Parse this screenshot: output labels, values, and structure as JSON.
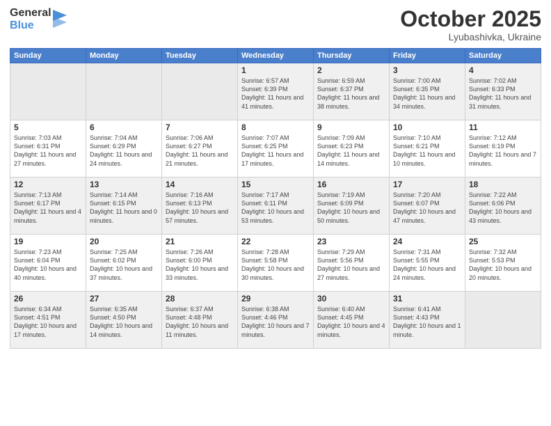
{
  "logo": {
    "general": "General",
    "blue": "Blue"
  },
  "header": {
    "month": "October 2025",
    "location": "Lyubashivka, Ukraine"
  },
  "weekdays": [
    "Sunday",
    "Monday",
    "Tuesday",
    "Wednesday",
    "Thursday",
    "Friday",
    "Saturday"
  ],
  "weeks": [
    [
      {
        "day": "",
        "sunrise": "",
        "sunset": "",
        "daylight": "",
        "empty": true
      },
      {
        "day": "",
        "sunrise": "",
        "sunset": "",
        "daylight": "",
        "empty": true
      },
      {
        "day": "",
        "sunrise": "",
        "sunset": "",
        "daylight": "",
        "empty": true
      },
      {
        "day": "1",
        "sunrise": "Sunrise: 6:57 AM",
        "sunset": "Sunset: 6:39 PM",
        "daylight": "Daylight: 11 hours and 41 minutes."
      },
      {
        "day": "2",
        "sunrise": "Sunrise: 6:59 AM",
        "sunset": "Sunset: 6:37 PM",
        "daylight": "Daylight: 11 hours and 38 minutes."
      },
      {
        "day": "3",
        "sunrise": "Sunrise: 7:00 AM",
        "sunset": "Sunset: 6:35 PM",
        "daylight": "Daylight: 11 hours and 34 minutes."
      },
      {
        "day": "4",
        "sunrise": "Sunrise: 7:02 AM",
        "sunset": "Sunset: 6:33 PM",
        "daylight": "Daylight: 11 hours and 31 minutes."
      }
    ],
    [
      {
        "day": "5",
        "sunrise": "Sunrise: 7:03 AM",
        "sunset": "Sunset: 6:31 PM",
        "daylight": "Daylight: 11 hours and 27 minutes."
      },
      {
        "day": "6",
        "sunrise": "Sunrise: 7:04 AM",
        "sunset": "Sunset: 6:29 PM",
        "daylight": "Daylight: 11 hours and 24 minutes."
      },
      {
        "day": "7",
        "sunrise": "Sunrise: 7:06 AM",
        "sunset": "Sunset: 6:27 PM",
        "daylight": "Daylight: 11 hours and 21 minutes."
      },
      {
        "day": "8",
        "sunrise": "Sunrise: 7:07 AM",
        "sunset": "Sunset: 6:25 PM",
        "daylight": "Daylight: 11 hours and 17 minutes."
      },
      {
        "day": "9",
        "sunrise": "Sunrise: 7:09 AM",
        "sunset": "Sunset: 6:23 PM",
        "daylight": "Daylight: 11 hours and 14 minutes."
      },
      {
        "day": "10",
        "sunrise": "Sunrise: 7:10 AM",
        "sunset": "Sunset: 6:21 PM",
        "daylight": "Daylight: 11 hours and 10 minutes."
      },
      {
        "day": "11",
        "sunrise": "Sunrise: 7:12 AM",
        "sunset": "Sunset: 6:19 PM",
        "daylight": "Daylight: 11 hours and 7 minutes."
      }
    ],
    [
      {
        "day": "12",
        "sunrise": "Sunrise: 7:13 AM",
        "sunset": "Sunset: 6:17 PM",
        "daylight": "Daylight: 11 hours and 4 minutes."
      },
      {
        "day": "13",
        "sunrise": "Sunrise: 7:14 AM",
        "sunset": "Sunset: 6:15 PM",
        "daylight": "Daylight: 11 hours and 0 minutes."
      },
      {
        "day": "14",
        "sunrise": "Sunrise: 7:16 AM",
        "sunset": "Sunset: 6:13 PM",
        "daylight": "Daylight: 10 hours and 57 minutes."
      },
      {
        "day": "15",
        "sunrise": "Sunrise: 7:17 AM",
        "sunset": "Sunset: 6:11 PM",
        "daylight": "Daylight: 10 hours and 53 minutes."
      },
      {
        "day": "16",
        "sunrise": "Sunrise: 7:19 AM",
        "sunset": "Sunset: 6:09 PM",
        "daylight": "Daylight: 10 hours and 50 minutes."
      },
      {
        "day": "17",
        "sunrise": "Sunrise: 7:20 AM",
        "sunset": "Sunset: 6:07 PM",
        "daylight": "Daylight: 10 hours and 47 minutes."
      },
      {
        "day": "18",
        "sunrise": "Sunrise: 7:22 AM",
        "sunset": "Sunset: 6:06 PM",
        "daylight": "Daylight: 10 hours and 43 minutes."
      }
    ],
    [
      {
        "day": "19",
        "sunrise": "Sunrise: 7:23 AM",
        "sunset": "Sunset: 6:04 PM",
        "daylight": "Daylight: 10 hours and 40 minutes."
      },
      {
        "day": "20",
        "sunrise": "Sunrise: 7:25 AM",
        "sunset": "Sunset: 6:02 PM",
        "daylight": "Daylight: 10 hours and 37 minutes."
      },
      {
        "day": "21",
        "sunrise": "Sunrise: 7:26 AM",
        "sunset": "Sunset: 6:00 PM",
        "daylight": "Daylight: 10 hours and 33 minutes."
      },
      {
        "day": "22",
        "sunrise": "Sunrise: 7:28 AM",
        "sunset": "Sunset: 5:58 PM",
        "daylight": "Daylight: 10 hours and 30 minutes."
      },
      {
        "day": "23",
        "sunrise": "Sunrise: 7:29 AM",
        "sunset": "Sunset: 5:56 PM",
        "daylight": "Daylight: 10 hours and 27 minutes."
      },
      {
        "day": "24",
        "sunrise": "Sunrise: 7:31 AM",
        "sunset": "Sunset: 5:55 PM",
        "daylight": "Daylight: 10 hours and 24 minutes."
      },
      {
        "day": "25",
        "sunrise": "Sunrise: 7:32 AM",
        "sunset": "Sunset: 5:53 PM",
        "daylight": "Daylight: 10 hours and 20 minutes."
      }
    ],
    [
      {
        "day": "26",
        "sunrise": "Sunrise: 6:34 AM",
        "sunset": "Sunset: 4:51 PM",
        "daylight": "Daylight: 10 hours and 17 minutes."
      },
      {
        "day": "27",
        "sunrise": "Sunrise: 6:35 AM",
        "sunset": "Sunset: 4:50 PM",
        "daylight": "Daylight: 10 hours and 14 minutes."
      },
      {
        "day": "28",
        "sunrise": "Sunrise: 6:37 AM",
        "sunset": "Sunset: 4:48 PM",
        "daylight": "Daylight: 10 hours and 11 minutes."
      },
      {
        "day": "29",
        "sunrise": "Sunrise: 6:38 AM",
        "sunset": "Sunset: 4:46 PM",
        "daylight": "Daylight: 10 hours and 7 minutes."
      },
      {
        "day": "30",
        "sunrise": "Sunrise: 6:40 AM",
        "sunset": "Sunset: 4:45 PM",
        "daylight": "Daylight: 10 hours and 4 minutes."
      },
      {
        "day": "31",
        "sunrise": "Sunrise: 6:41 AM",
        "sunset": "Sunset: 4:43 PM",
        "daylight": "Daylight: 10 hours and 1 minute."
      },
      {
        "day": "",
        "sunrise": "",
        "sunset": "",
        "daylight": "",
        "empty": true
      }
    ]
  ]
}
